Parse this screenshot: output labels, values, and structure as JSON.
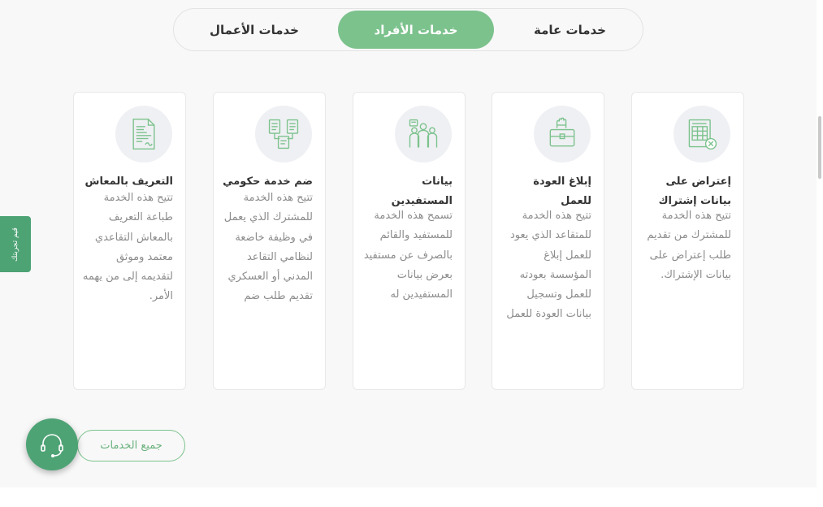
{
  "tabs": [
    {
      "label": "خدمات عامة",
      "active": false
    },
    {
      "label": "خدمات الأفراد",
      "active": true
    },
    {
      "label": "خدمات الأعمال",
      "active": false
    }
  ],
  "cards": [
    {
      "title": "إعتراض على بيانات إشتراك",
      "description": "تتيح هذه الخدمة للمشترك من تقديم طلب إعتراض على بيانات الإشتراك.",
      "icon": "spreadsheet-objection-icon"
    },
    {
      "title": "إبلاغ العودة للعمل",
      "description": "تتيح هذه الخدمة للمتقاعد الذي يعود للعمل إبلاغ المؤسسة بعودته للعمل وتسجيل بيانات العودة للعمل",
      "icon": "briefcase-hand-icon"
    },
    {
      "title": "بيانات المستفيدين",
      "description": "تسمح هذه الخدمة للمستفيد والقائم بالصرف عن مستفيد بعرض بيانات المستفيدين له",
      "icon": "beneficiaries-group-icon"
    },
    {
      "title": "ضم خدمة حكومي",
      "description": "تتيح هذه الخدمة للمشترك الذي يعمل في وظيفة خاضعة لنظامي التقاعد المدني أو العسكري تقديم طلب ضم",
      "icon": "merge-documents-icon"
    },
    {
      "title": "التعريف بالمعاش",
      "description": "تتيح هذه الخدمة طباعة التعريف بالمعاش التقاعدي معتمد وموثق لتقديمه إلى من يهمه الأمر.",
      "icon": "certificate-document-icon"
    }
  ],
  "help_tab_label": "قيم تجربتك",
  "all_services_label": "جميع الخدمات",
  "support_icon": "headset-icon",
  "colors": {
    "accent": "#7cc28d",
    "accent_dark": "#4ea375",
    "title_text": "#333333",
    "body_text": "#8c8c8c",
    "section_bg": "#f8f8f8",
    "icon_circle_bg": "#eff0f3"
  }
}
